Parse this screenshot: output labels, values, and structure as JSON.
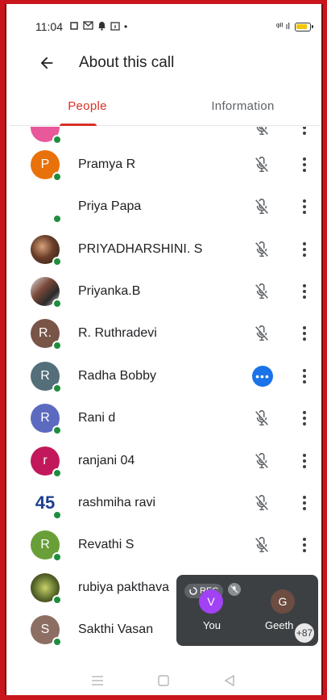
{
  "status": {
    "time": "11:04",
    "signal": "ᵠᴵᴵ ıl"
  },
  "header": {
    "title": "About this call"
  },
  "tabs": [
    {
      "label": "People",
      "active": true
    },
    {
      "label": "Information",
      "active": false
    }
  ],
  "participants": [
    {
      "name": "",
      "avatar_letter": "",
      "avatar_color": "#e8589a",
      "avatar_type": "letter",
      "online": true,
      "status": "muted"
    },
    {
      "name": "Pramya R",
      "avatar_letter": "P",
      "avatar_color": "#e8710a",
      "avatar_type": "letter",
      "online": true,
      "status": "muted"
    },
    {
      "name": "Priya Papa",
      "avatar_letter": "",
      "avatar_color": "#ffffff",
      "avatar_type": "blank",
      "online": true,
      "status": "muted"
    },
    {
      "name": "PRIYADHARSHINI. S",
      "avatar_letter": "",
      "avatar_color": "#6b3f2a",
      "avatar_type": "photo",
      "online": true,
      "status": "muted"
    },
    {
      "name": "Priyanka.B",
      "avatar_letter": "",
      "avatar_color": "#7a4a3a",
      "avatar_type": "photo2",
      "online": true,
      "status": "muted"
    },
    {
      "name": "R. Ruthradevi",
      "avatar_letter": "R.",
      "avatar_color": "#795548",
      "avatar_type": "letter",
      "online": true,
      "status": "muted"
    },
    {
      "name": "Radha Bobby",
      "avatar_letter": "R",
      "avatar_color": "#546e7a",
      "avatar_type": "letter",
      "online": true,
      "status": "speaking"
    },
    {
      "name": "Rani d",
      "avatar_letter": "R",
      "avatar_color": "#5c6bc0",
      "avatar_type": "letter",
      "online": true,
      "status": "muted"
    },
    {
      "name": "ranjani 04",
      "avatar_letter": "r",
      "avatar_color": "#c2185b",
      "avatar_type": "letter",
      "online": true,
      "status": "muted"
    },
    {
      "name": "rashmiha ravi",
      "avatar_letter": "45",
      "avatar_color": "#1d3f8f",
      "avatar_type": "num",
      "online": true,
      "status": "muted"
    },
    {
      "name": "Revathi S",
      "avatar_letter": "R",
      "avatar_color": "#689f38",
      "avatar_type": "letter",
      "online": true,
      "status": "muted"
    },
    {
      "name": "rubiya pakthava",
      "avatar_letter": "",
      "avatar_color": "#5b6b2b",
      "avatar_type": "book",
      "online": true,
      "status": "muted"
    },
    {
      "name": "Sakthi Vasan",
      "avatar_letter": "S",
      "avatar_color": "#8d6e63",
      "avatar_type": "letter",
      "online": true,
      "status": "muted"
    }
  ],
  "pip": {
    "rec_label": "REC",
    "tiles": [
      {
        "letter": "V",
        "label": "You",
        "color": "#a142f4"
      },
      {
        "letter": "G",
        "label": "Geeth",
        "color": "#6d4c41"
      }
    ],
    "more_count": "+87"
  },
  "colors": {
    "accent": "#d93025",
    "speaking": "#1a73e8",
    "online": "#1e8e3e"
  }
}
